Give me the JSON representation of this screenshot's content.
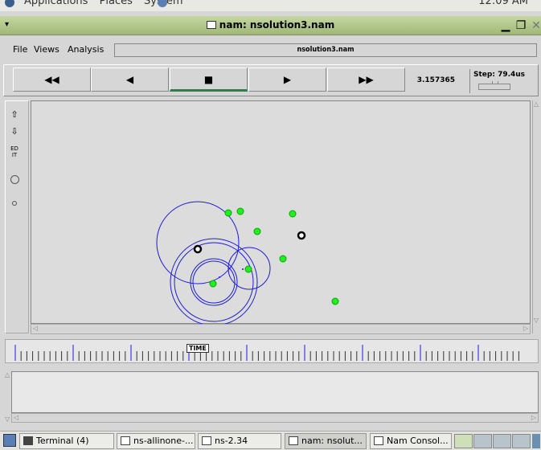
{
  "system_panel": {
    "menus": [
      "Applications",
      "Places",
      "System"
    ],
    "clock": "12:09 AM"
  },
  "window": {
    "title": "nam: nsolution3.nam",
    "menu_arrow": "▾",
    "minimize": "▁",
    "maximize": "❐",
    "close": "✕"
  },
  "menubar": {
    "file": "File",
    "views": "Views",
    "analysis": "Analysis",
    "filename": "nsolution3.nam"
  },
  "controls": {
    "rewind": "◀◀",
    "back": "◀",
    "stop": "■",
    "play": "▶",
    "fast_forward": "▶▶",
    "time": "3.157365",
    "step_label": "Step: 79.4us"
  },
  "toolbar": {
    "zoom_in": "⇧",
    "zoom_out": "⇩",
    "edit": "ED\nIT"
  },
  "timeline": {
    "time_label": "TIME"
  },
  "taskbar": {
    "items": [
      {
        "label": "Terminal (4)"
      },
      {
        "label": "ns-allinone-..."
      },
      {
        "label": "ns-2.34"
      },
      {
        "label": "nam: nsolut..."
      },
      {
        "label": "Nam Consol..."
      }
    ]
  },
  "colors": {
    "titlebar": "#b3c98e",
    "node_green": "#22ee22",
    "node_black": "#000000",
    "range_circle": "#1c1cd8",
    "active_indicator": "#2e7d4f"
  }
}
